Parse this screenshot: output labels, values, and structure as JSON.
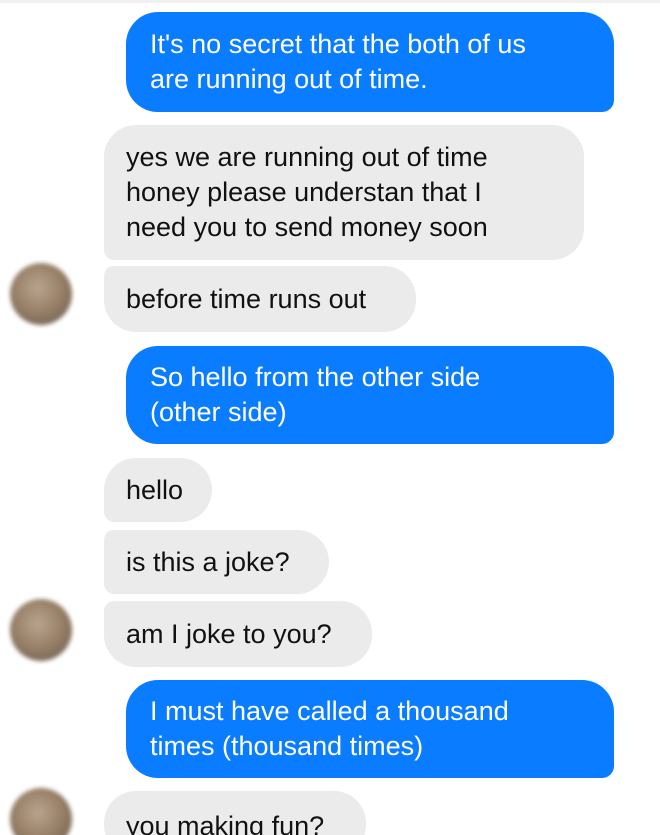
{
  "colors": {
    "outgoing_bubble": "#0a7cff",
    "incoming_bubble": "#ebebeb",
    "outgoing_text": "#ffffff",
    "incoming_text": "#111111"
  },
  "messages": [
    {
      "direction": "outgoing",
      "lines": [
        "It's no secret that the both of us",
        "are running out of time."
      ]
    },
    {
      "direction": "incoming",
      "lines": [
        "yes we are running out of time",
        "honey please understan that I",
        "need you to send money soon"
      ]
    },
    {
      "direction": "incoming",
      "avatar": "blurred-avatar",
      "lines": [
        "before time runs out"
      ]
    },
    {
      "direction": "outgoing",
      "lines": [
        "So hello from the other side",
        "(other side)"
      ]
    },
    {
      "direction": "incoming",
      "lines": [
        "hello"
      ]
    },
    {
      "direction": "incoming",
      "lines": [
        "is this a joke?"
      ]
    },
    {
      "direction": "incoming",
      "avatar": "blurred-avatar",
      "lines": [
        "am I joke to you?"
      ]
    },
    {
      "direction": "outgoing",
      "lines": [
        "I must have called a thousand",
        "times (thousand times)"
      ]
    },
    {
      "direction": "incoming",
      "avatar": "blurred-avatar",
      "lines": [
        "you making fun?"
      ]
    }
  ]
}
